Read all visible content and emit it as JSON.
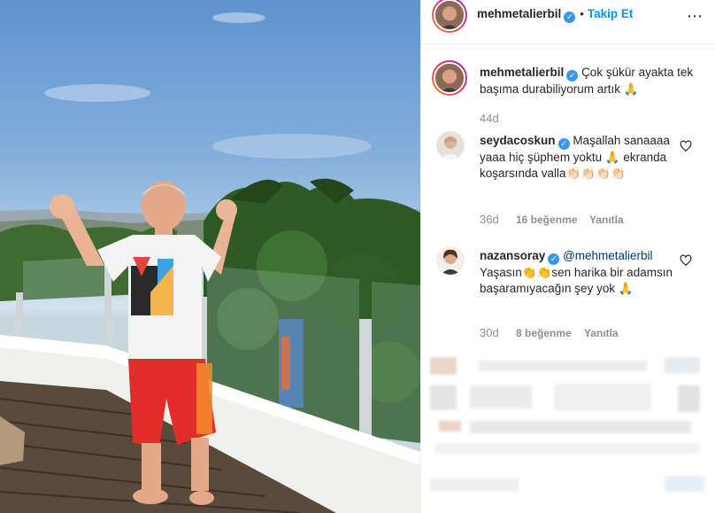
{
  "post": {
    "username": "mehmetalierbil",
    "verified": true,
    "separator": "•",
    "follow_label": "Takip Et",
    "more_icon": "⋯"
  },
  "caption": {
    "username": "mehmetalierbil",
    "text": "Çok şükür ayakta tek başıma durabiliyorum artık 🙏",
    "time": "44d"
  },
  "comments": [
    {
      "username": "seydacoskun",
      "text": "Maşallah sanaaaa yaaa hiç şüphem yoktu 🙏 ekranda koşarsında valla👏🏻👏🏻👏🏻👏🏻",
      "time": "36d",
      "likes": "16 beğenme",
      "reply": "Yanıtla"
    },
    {
      "username": "nazansoray",
      "mention": "@mehmetalierbil",
      "text": "Yaşasın👏👏sen harika bir adamsın başaramıyacağın şey yok 🙏",
      "time": "30d",
      "likes": "8 beğenme",
      "reply": "Yanıtla"
    }
  ],
  "colors": {
    "accent": "#0095f6",
    "verified": "#3897f0",
    "text": "#262626",
    "muted": "#8e8e8e"
  }
}
